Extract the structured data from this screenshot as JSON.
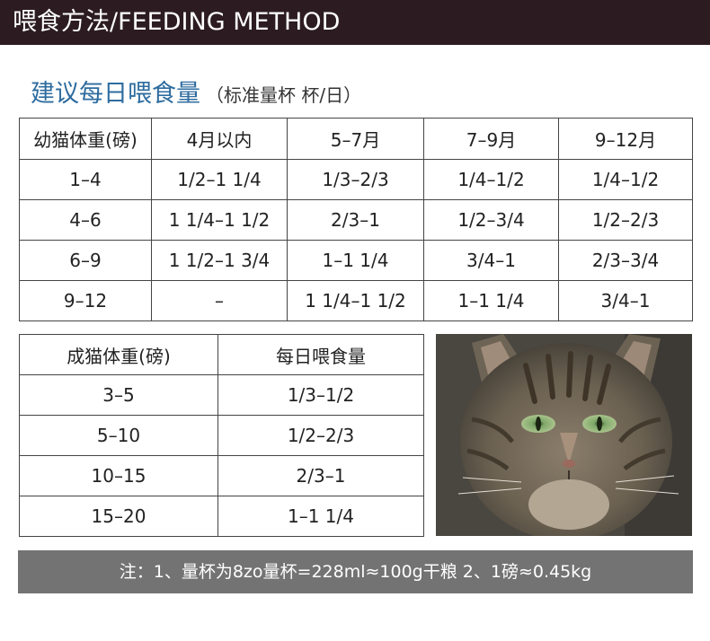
{
  "header": {
    "title": "喂食方法/FEEDING METHOD"
  },
  "section": {
    "title": "建议每日喂食量",
    "subtitle": "（标准量杯  杯/日）"
  },
  "kitten_table": {
    "headers": [
      "幼猫体重(磅)",
      "4月以内",
      "5–7月",
      "7–9月",
      "9–12月"
    ],
    "rows": [
      [
        "1–4",
        "1/2–1 1/4",
        "1/3–2/3",
        "1/4–1/2",
        "1/4–1/2"
      ],
      [
        "4–6",
        "1 1/4–1 1/2",
        "2/3–1",
        "1/2–3/4",
        "1/2–2/3"
      ],
      [
        "6–9",
        "1 1/2–1 3/4",
        "1–1 1/4",
        "3/4–1",
        "2/3–3/4"
      ],
      [
        "9–12",
        "–",
        "1 1/4–1 1/2",
        "1–1 1/4",
        "3/4–1"
      ]
    ]
  },
  "adult_table": {
    "headers": [
      "成猫体重(磅)",
      "每日喂食量"
    ],
    "rows": [
      [
        "3–5",
        "1/3–1/2"
      ],
      [
        "5–10",
        "1/2–2/3"
      ],
      [
        "10–15",
        "2/3–1"
      ],
      [
        "15–20",
        "1–1 1/4"
      ]
    ]
  },
  "note": {
    "text": "注：1、量杯为8zo量杯=228ml≈100g干粮   2、1磅≈0.45kg"
  },
  "colors": {
    "header_bg": "#2c1c22",
    "title_blue": "#2e6c9f",
    "note_bg": "#737373",
    "border": "#444444"
  },
  "icons": {
    "photo": "cat-photo-icon"
  }
}
